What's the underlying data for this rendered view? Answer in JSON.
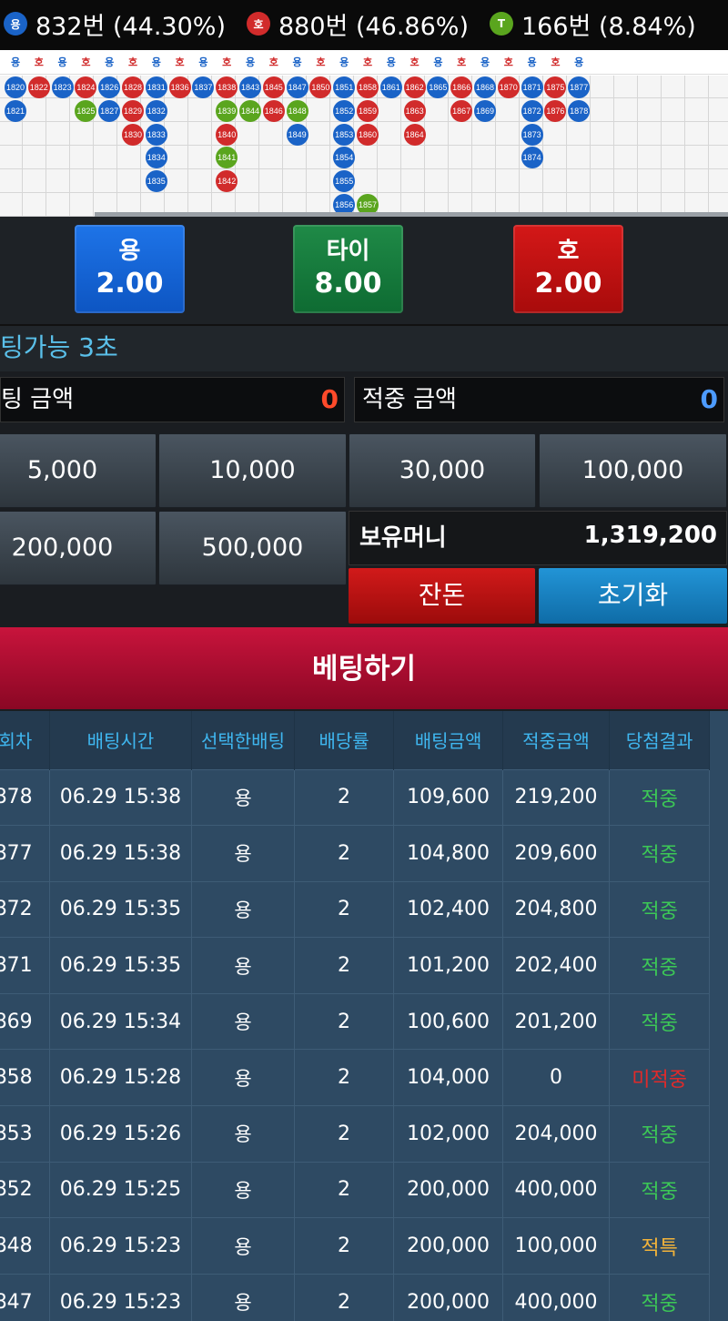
{
  "stats": [
    {
      "icon": "dragon-badge",
      "badge": "용",
      "color": "#1a63c7",
      "text": "832번 (44.30%)"
    },
    {
      "icon": "tiger-badge",
      "badge": "호",
      "color": "#d12b2b",
      "text": "880번 (46.86%)"
    },
    {
      "icon": "tie-badge",
      "badge": "T",
      "color": "#5aa51e",
      "text": "166번 (8.84%)"
    }
  ],
  "road": {
    "header": [
      "용",
      "호",
      "용",
      "호",
      "용",
      "호",
      "용",
      "호",
      "용",
      "호",
      "용",
      "호",
      "용",
      "호",
      "용",
      "호",
      "용",
      "호",
      "용",
      "호",
      "용",
      "호",
      "용",
      "호",
      "용"
    ],
    "columns": [
      [
        {
          "n": "1820",
          "c": "b"
        },
        {
          "n": "1821",
          "c": "b"
        }
      ],
      [
        {
          "n": "1822",
          "c": "r"
        }
      ],
      [
        {
          "n": "1823",
          "c": "b"
        }
      ],
      [
        {
          "n": "1824",
          "c": "r"
        },
        {
          "n": "1825",
          "c": "g"
        }
      ],
      [
        {
          "n": "1826",
          "c": "b"
        },
        {
          "n": "1827",
          "c": "b"
        }
      ],
      [
        {
          "n": "1828",
          "c": "r"
        },
        {
          "n": "1829",
          "c": "r"
        },
        {
          "n": "1830",
          "c": "r"
        }
      ],
      [
        {
          "n": "1831",
          "c": "b"
        },
        {
          "n": "1832",
          "c": "b"
        },
        {
          "n": "1833",
          "c": "b"
        },
        {
          "n": "1834",
          "c": "b"
        },
        {
          "n": "1835",
          "c": "b"
        }
      ],
      [
        {
          "n": "1836",
          "c": "r"
        }
      ],
      [
        {
          "n": "1837",
          "c": "b"
        }
      ],
      [
        {
          "n": "1838",
          "c": "r"
        },
        {
          "n": "1839",
          "c": "g"
        },
        {
          "n": "1840",
          "c": "r"
        },
        {
          "n": "1841",
          "c": "g"
        },
        {
          "n": "1842",
          "c": "r"
        }
      ],
      [
        {
          "n": "1843",
          "c": "b"
        },
        {
          "n": "1844",
          "c": "g"
        }
      ],
      [
        {
          "n": "1845",
          "c": "r"
        },
        {
          "n": "1846",
          "c": "r"
        }
      ],
      [
        {
          "n": "1847",
          "c": "b"
        },
        {
          "n": "1848",
          "c": "g"
        },
        {
          "n": "1849",
          "c": "b"
        }
      ],
      [
        {
          "n": "1850",
          "c": "r"
        }
      ],
      [
        {
          "n": "1851",
          "c": "b"
        },
        {
          "n": "1852",
          "c": "b"
        },
        {
          "n": "1853",
          "c": "b"
        },
        {
          "n": "1854",
          "c": "b"
        },
        {
          "n": "1855",
          "c": "b"
        },
        {
          "n": "1856",
          "c": "b"
        }
      ],
      [
        {
          "n": "1858",
          "c": "r"
        },
        {
          "n": "1859",
          "c": "r"
        },
        {
          "n": "1860",
          "c": "r"
        },
        null,
        null,
        {
          "n": "1857",
          "c": "g"
        }
      ],
      [
        {
          "n": "1861",
          "c": "b"
        }
      ],
      [
        {
          "n": "1862",
          "c": "r"
        },
        {
          "n": "1863",
          "c": "r"
        },
        {
          "n": "1864",
          "c": "r"
        }
      ],
      [
        {
          "n": "1865",
          "c": "b"
        }
      ],
      [
        {
          "n": "1866",
          "c": "r"
        },
        {
          "n": "1867",
          "c": "r"
        }
      ],
      [
        {
          "n": "1868",
          "c": "b"
        },
        {
          "n": "1869",
          "c": "b"
        }
      ],
      [
        {
          "n": "1870",
          "c": "r"
        }
      ],
      [
        {
          "n": "1871",
          "c": "b"
        },
        {
          "n": "1872",
          "c": "b"
        },
        {
          "n": "1873",
          "c": "b"
        },
        {
          "n": "1874",
          "c": "b"
        }
      ],
      [
        {
          "n": "1875",
          "c": "r"
        },
        {
          "n": "1876",
          "c": "r"
        }
      ],
      [
        {
          "n": "1877",
          "c": "b"
        },
        {
          "n": "1878",
          "c": "b"
        }
      ]
    ]
  },
  "bets": [
    {
      "label": "용",
      "odds": "2.00"
    },
    {
      "label": "타이",
      "odds": "8.00"
    },
    {
      "label": "호",
      "odds": "2.00"
    }
  ],
  "timer_text": "팅가능 3초",
  "bet_amount": {
    "label": "팅 금액",
    "value": "0"
  },
  "win_amount": {
    "label": "적중 금액",
    "value": "0"
  },
  "chips": [
    "5,000",
    "10,000",
    "30,000",
    "100,000",
    "200,000",
    "500,000"
  ],
  "balance": {
    "label": "보유머니",
    "value": "1,319,200"
  },
  "buttons": {
    "change": "잔돈",
    "reset": "초기화",
    "place_bet": "베팅하기"
  },
  "history": {
    "headers": [
      "회차",
      "배팅시간",
      "선택한배팅",
      "배당률",
      "배팅금액",
      "적중금액",
      "당첨결과"
    ],
    "rows": [
      [
        "878",
        "06.29 15:38",
        "용",
        "2",
        "109,600",
        "219,200",
        "적중"
      ],
      [
        "877",
        "06.29 15:38",
        "용",
        "2",
        "104,800",
        "209,600",
        "적중"
      ],
      [
        "872",
        "06.29 15:35",
        "용",
        "2",
        "102,400",
        "204,800",
        "적중"
      ],
      [
        "871",
        "06.29 15:35",
        "용",
        "2",
        "101,200",
        "202,400",
        "적중"
      ],
      [
        "869",
        "06.29 15:34",
        "용",
        "2",
        "100,600",
        "201,200",
        "적중"
      ],
      [
        "858",
        "06.29 15:28",
        "용",
        "2",
        "104,000",
        "0",
        "미적중"
      ],
      [
        "853",
        "06.29 15:26",
        "용",
        "2",
        "102,000",
        "204,000",
        "적중"
      ],
      [
        "852",
        "06.29 15:25",
        "용",
        "2",
        "200,000",
        "400,000",
        "적중"
      ],
      [
        "848",
        "06.29 15:23",
        "용",
        "2",
        "200,000",
        "100,000",
        "적특"
      ],
      [
        "847",
        "06.29 15:23",
        "용",
        "2",
        "200,000",
        "400,000",
        "적중"
      ]
    ]
  }
}
